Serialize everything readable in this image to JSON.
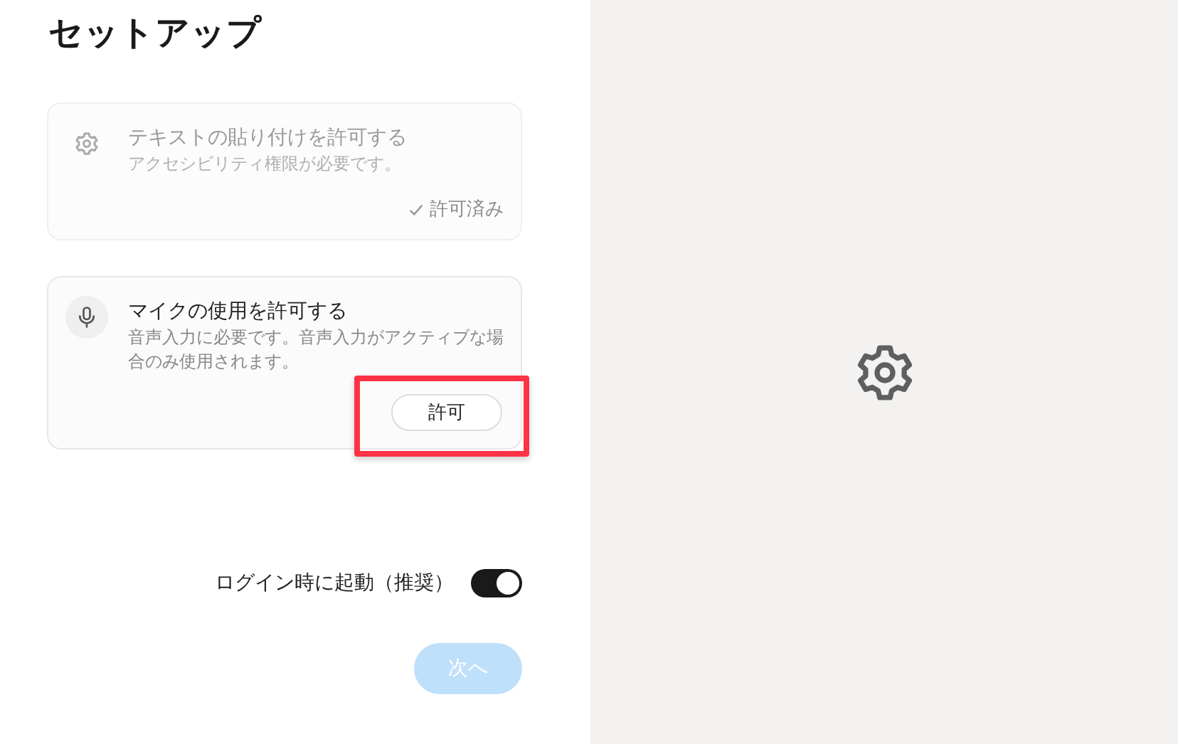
{
  "title": "セットアップ",
  "permissions": [
    {
      "kind": "gear",
      "title": "テキストの貼り付けを許可する",
      "description": "アクセシビリティ権限が必要です。",
      "granted": true,
      "status": "許可済み"
    },
    {
      "kind": "mic",
      "title": "マイクの使用を許可する",
      "description": "音声入力に必要です。音声入力がアクティブな場合のみ使用されます。",
      "granted": false,
      "button": "許可",
      "highlighted": true
    }
  ],
  "launch_at_login": {
    "label": "ログイン時に起動（推奨）",
    "on": true
  },
  "next_button": {
    "label": "次へ",
    "disabled": true
  }
}
